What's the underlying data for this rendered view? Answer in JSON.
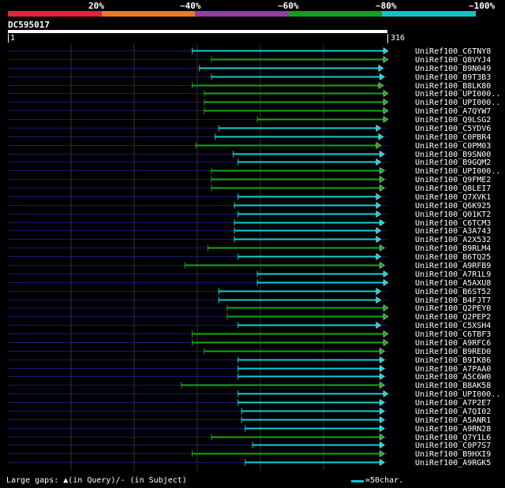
{
  "scale": {
    "labels": [
      "20%",
      "~40%",
      "~60%",
      "~80%",
      "~100%"
    ],
    "colors": [
      "#e8213c",
      "#ec7a22",
      "#9b3aa0",
      "#14a01a",
      "#10c3c8"
    ]
  },
  "query": {
    "id": "DC595017",
    "start": "1",
    "end": "316"
  },
  "footer": {
    "gaps_text": "Large gaps: ▲(in Query)/- (in Subject)",
    "legend_text": "=50char."
  },
  "colors": {
    "cyan": "#10d0d8",
    "green": "#13a81b",
    "navy": "#1a1a6e",
    "background": "#000000"
  },
  "chart_data": {
    "type": "alignment",
    "query_length": 316,
    "hits": [
      {
        "name": "UniRef100_C6TNY8",
        "start": 154,
        "end": 316,
        "color": "cyan"
      },
      {
        "name": "UniRef100_Q8VYJ4",
        "start": 170,
        "end": 316,
        "color": "green"
      },
      {
        "name": "UniRef100_B9N049",
        "start": 160,
        "end": 312,
        "color": "cyan"
      },
      {
        "name": "UniRef100_B9T3B3",
        "start": 170,
        "end": 313,
        "color": "cyan"
      },
      {
        "name": "UniRef100_B8LK80",
        "start": 154,
        "end": 312,
        "color": "green"
      },
      {
        "name": "UniRef100_UPI000..",
        "start": 164,
        "end": 316,
        "color": "green"
      },
      {
        "name": "UniRef100_UPI000..",
        "start": 164,
        "end": 316,
        "color": "green"
      },
      {
        "name": "UniRef100_A7QYW7",
        "start": 164,
        "end": 316,
        "color": "green"
      },
      {
        "name": "UniRef100_Q9LSG2",
        "start": 208,
        "end": 316,
        "color": "green"
      },
      {
        "name": "UniRef100_C5YDV6",
        "start": 176,
        "end": 310,
        "color": "cyan"
      },
      {
        "name": "UniRef100_C0PBR4",
        "start": 173,
        "end": 312,
        "color": "cyan"
      },
      {
        "name": "UniRef100_C0PM03",
        "start": 157,
        "end": 310,
        "color": "green"
      },
      {
        "name": "UniRef100_B9SN00",
        "start": 188,
        "end": 313,
        "color": "cyan"
      },
      {
        "name": "UniRef100_B9GQM2",
        "start": 192,
        "end": 310,
        "color": "cyan"
      },
      {
        "name": "UniRef100_UPI000..",
        "start": 170,
        "end": 313,
        "color": "green"
      },
      {
        "name": "UniRef100_Q9FME2",
        "start": 170,
        "end": 313,
        "color": "green"
      },
      {
        "name": "UniRef100_Q8LEI7",
        "start": 170,
        "end": 313,
        "color": "green"
      },
      {
        "name": "UniRef100_Q7XVK1",
        "start": 192,
        "end": 310,
        "color": "cyan"
      },
      {
        "name": "UniRef100_Q6K925",
        "start": 189,
        "end": 310,
        "color": "cyan"
      },
      {
        "name": "UniRef100_Q01KT2",
        "start": 192,
        "end": 310,
        "color": "cyan"
      },
      {
        "name": "UniRef100_C6TCM3",
        "start": 189,
        "end": 313,
        "color": "cyan"
      },
      {
        "name": "UniRef100_A3A743",
        "start": 189,
        "end": 310,
        "color": "cyan"
      },
      {
        "name": "UniRef100_A2X532",
        "start": 189,
        "end": 310,
        "color": "cyan"
      },
      {
        "name": "UniRef100_B9RLM4",
        "start": 167,
        "end": 313,
        "color": "green"
      },
      {
        "name": "UniRef100_B6TQ25",
        "start": 192,
        "end": 310,
        "color": "cyan"
      },
      {
        "name": "UniRef100_A9RFB9",
        "start": 148,
        "end": 313,
        "color": "green"
      },
      {
        "name": "UniRef100_A7R1L9",
        "start": 208,
        "end": 316,
        "color": "cyan"
      },
      {
        "name": "UniRef100_A5AXU8",
        "start": 208,
        "end": 316,
        "color": "cyan"
      },
      {
        "name": "UniRef100_B6ST52",
        "start": 176,
        "end": 310,
        "color": "cyan"
      },
      {
        "name": "UniRef100_B4FJT7",
        "start": 176,
        "end": 310,
        "color": "cyan"
      },
      {
        "name": "UniRef100_Q2PEY0",
        "start": 183,
        "end": 316,
        "color": "green"
      },
      {
        "name": "UniRef100_Q2PEP2",
        "start": 183,
        "end": 316,
        "color": "green"
      },
      {
        "name": "UniRef100_C5XSH4",
        "start": 192,
        "end": 310,
        "color": "cyan"
      },
      {
        "name": "UniRef100_C6TBF3",
        "start": 154,
        "end": 316,
        "color": "green"
      },
      {
        "name": "UniRef100_A9RFC6",
        "start": 154,
        "end": 316,
        "color": "green"
      },
      {
        "name": "UniRef100_B9RED0",
        "start": 164,
        "end": 313,
        "color": "green"
      },
      {
        "name": "UniRef100_B9IK86",
        "start": 192,
        "end": 313,
        "color": "cyan"
      },
      {
        "name": "UniRef100_A7PAA0",
        "start": 192,
        "end": 313,
        "color": "cyan"
      },
      {
        "name": "UniRef100_A5C6W0",
        "start": 192,
        "end": 313,
        "color": "cyan"
      },
      {
        "name": "UniRef100_B8AK58",
        "start": 145,
        "end": 313,
        "color": "green"
      },
      {
        "name": "UniRef100_UPI000..",
        "start": 192,
        "end": 316,
        "color": "cyan"
      },
      {
        "name": "UniRef100_A7P2E7",
        "start": 192,
        "end": 313,
        "color": "cyan"
      },
      {
        "name": "UniRef100_A7QI02",
        "start": 195,
        "end": 313,
        "color": "cyan"
      },
      {
        "name": "UniRef100_A5ANR1",
        "start": 195,
        "end": 313,
        "color": "cyan"
      },
      {
        "name": "UniRef100_A9RN28",
        "start": 198,
        "end": 313,
        "color": "cyan"
      },
      {
        "name": "UniRef100_Q7Y1L6",
        "start": 170,
        "end": 313,
        "color": "green"
      },
      {
        "name": "UniRef100_C0P7S7",
        "start": 204,
        "end": 313,
        "color": "cyan"
      },
      {
        "name": "UniRef100_B9HXI9",
        "start": 154,
        "end": 313,
        "color": "green"
      },
      {
        "name": "UniRef100_A9RGK5",
        "start": 198,
        "end": 313,
        "color": "cyan"
      }
    ]
  }
}
